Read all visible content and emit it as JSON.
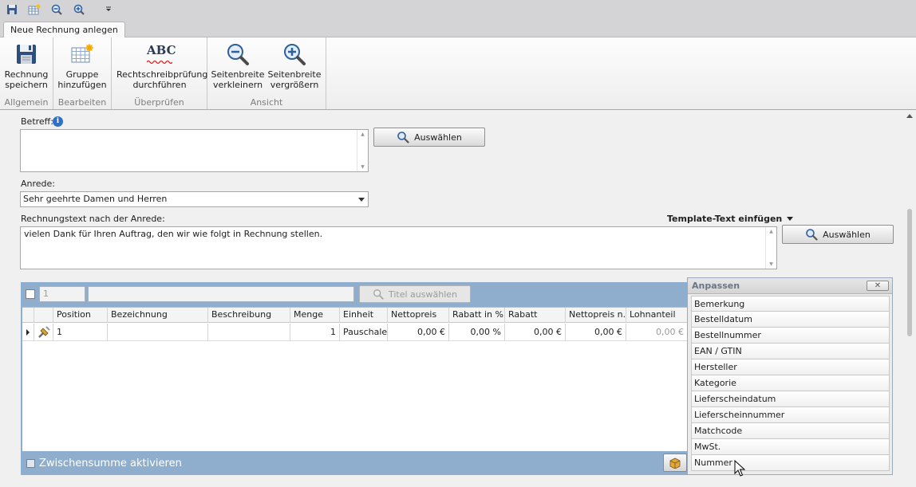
{
  "tab": {
    "label": "Neue Rechnung anlegen"
  },
  "ribbon": {
    "groups": [
      {
        "label": "Allgemein",
        "buttons": [
          {
            "line1": "Rechnung",
            "line2": "speichern"
          }
        ]
      },
      {
        "label": "Bearbeiten",
        "buttons": [
          {
            "line1": "Gruppe",
            "line2": "hinzufügen"
          }
        ]
      },
      {
        "label": "Überprüfen",
        "buttons": [
          {
            "line1": "Rechtschreibprüfung",
            "line2": "durchführen"
          }
        ]
      },
      {
        "label": "Ansicht",
        "buttons": [
          {
            "line1": "Seitenbreite",
            "line2": "verkleinern"
          },
          {
            "line1": "Seitenbreite",
            "line2": "vergrößern"
          }
        ]
      }
    ],
    "spell_icon_text": "ABC"
  },
  "form": {
    "betreff_label": "Betreff:",
    "betreff_value": "",
    "auswaehlen_label": "Auswählen",
    "anrede_label": "Anrede:",
    "anrede_value": "Sehr geehrte Damen und Herren",
    "text_label": "Rechnungstext nach der Anrede:",
    "template_label": "Template-Text einfügen",
    "text_value": "vielen Dank für Ihren Auftrag, den wir wie folgt in Rechnung stellen."
  },
  "grid": {
    "position_input": "1",
    "title_input": "",
    "title_button": "Titel auswählen",
    "columns": [
      "Position",
      "Bezeichnung",
      "Beschreibung",
      "Menge",
      "Einheit",
      "Nettopreis",
      "Rabatt in %",
      "Rabatt",
      "Nettopreis n...",
      "Lohnanteil"
    ],
    "rows": [
      {
        "position": "1",
        "bezeichnung": "",
        "beschreibung": "",
        "menge": "1",
        "einheit": "Pauschale",
        "nettopreis": "0,00 €",
        "rabatt_pct": "0,00 %",
        "rabatt": "0,00 €",
        "nettopreis_n": "0,00 €",
        "lohnanteil": "0,00 €"
      }
    ],
    "subtotal_label": "Zwischensumme aktivieren"
  },
  "customize": {
    "title": "Anpassen",
    "items": [
      "Bemerkung",
      "Bestelldatum",
      "Bestellnummer",
      "EAN / GTIN",
      "Hersteller",
      "Kategorie",
      "Lieferscheindatum",
      "Lieferscheinnummer",
      "Matchcode",
      "MwSt.",
      "Nummer"
    ]
  },
  "colors": {
    "grid_frame": "#8fadcc",
    "accent": "#1f6fc5"
  }
}
